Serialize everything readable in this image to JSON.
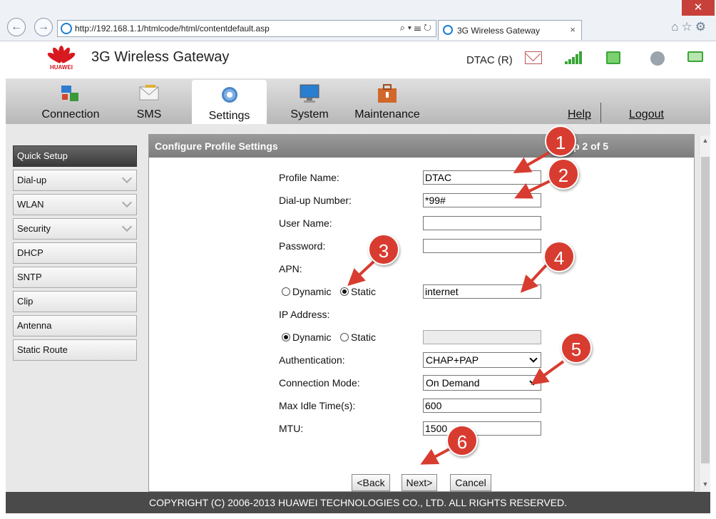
{
  "browser": {
    "url": "http://192.168.1.1/htmlcode/html/contentdefault.asp",
    "url_tools": "⌕ ▾ ☰ ↻",
    "tab_title": "3G Wireless Gateway",
    "tab_close": "×",
    "back": "←",
    "forward": "→",
    "window_close": "✕",
    "toolbar_icons": "⌂☆⚙"
  },
  "header": {
    "brand": "HUAWEI",
    "title": "3G Wireless Gateway",
    "carrier": "DTAC (R)"
  },
  "tabs": [
    {
      "label": "Connection"
    },
    {
      "label": "SMS"
    },
    {
      "label": "Settings"
    },
    {
      "label": "System"
    },
    {
      "label": "Maintenance"
    }
  ],
  "links": {
    "help": "Help",
    "logout": "Logout"
  },
  "sidebar": [
    {
      "label": "Quick Setup"
    },
    {
      "label": "Dial-up"
    },
    {
      "label": "WLAN"
    },
    {
      "label": "Security"
    },
    {
      "label": "DHCP"
    },
    {
      "label": "SNTP"
    },
    {
      "label": "Clip"
    },
    {
      "label": "Antenna"
    },
    {
      "label": "Static Route"
    }
  ],
  "panel": {
    "title": "Configure Profile Settings",
    "step": "p 2 of 5"
  },
  "form": {
    "profile_name_label": "Profile Name:",
    "profile_name": "DTAC",
    "dialup_label": "Dial-up Number:",
    "dialup": "*99#",
    "username_label": "User Name:",
    "username": "",
    "password_label": "Password:",
    "password": "",
    "apn_label": "APN:",
    "apn_dynamic": "Dynamic",
    "apn_static": "Static",
    "apn_value": "internet",
    "ip_label": "IP Address:",
    "ip_dynamic": "Dynamic",
    "ip_static": "Static",
    "auth_label": "Authentication:",
    "auth_value": "CHAP+PAP",
    "mode_label": "Connection Mode:",
    "mode_value": "On Demand",
    "idle_label": "Max Idle Time(s):",
    "idle_value": "600",
    "mtu_label": "MTU:",
    "mtu_value": "1500"
  },
  "buttons": {
    "back": "<Back",
    "next": "Next>",
    "cancel": "Cancel"
  },
  "footer": "COPYRIGHT (C) 2006-2013 HUAWEI TECHNOLOGIES CO., LTD. ALL RIGHTS RESERVED.",
  "callouts": [
    "1",
    "2",
    "3",
    "4",
    "5",
    "6"
  ],
  "colors": {
    "accent": "#d83c30",
    "header_bar": "#4a4a4a",
    "huawei_red": "#d71920",
    "status_green": "#3aa537"
  }
}
